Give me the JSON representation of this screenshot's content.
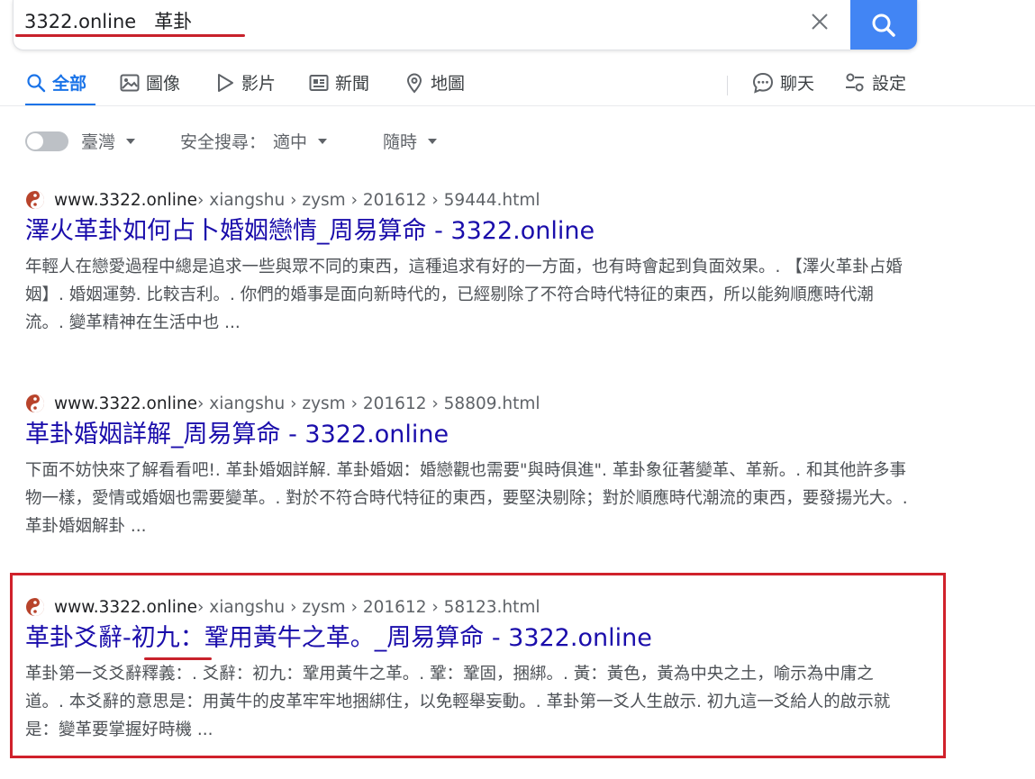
{
  "search": {
    "query": "3322.online   革卦",
    "colors": {
      "accent": "#4285f4",
      "annotation": "#c8212b"
    }
  },
  "tabs": [
    {
      "label": "全部",
      "icon": "search-icon",
      "active": true
    },
    {
      "label": "圖像",
      "icon": "image-icon"
    },
    {
      "label": "影片",
      "icon": "play-icon"
    },
    {
      "label": "新聞",
      "icon": "news-icon"
    },
    {
      "label": "地圖",
      "icon": "map-pin-icon"
    }
  ],
  "actions": [
    {
      "label": "聊天",
      "icon": "chat-icon"
    },
    {
      "label": "設定",
      "icon": "settings-sliders-icon"
    }
  ],
  "filters": {
    "region": "臺灣",
    "safe_search_label": "安全搜尋：",
    "safe_search_value": "適中",
    "time": "隨時"
  },
  "results": [
    {
      "site": "www.3322.online",
      "crumbs": " › xiangshu › zysm › 201612 › 59444.html",
      "title": "澤火革卦如何占卜婚姻戀情_周易算命 - 3322.online",
      "snippet": "年輕人在戀愛過程中總是追求一些與眾不同的東西，這種追求有好的一方面，也有時會起到負面效果。. 【澤火革卦占婚姻】. 婚姻運勢. 比較吉利。. 你們的婚事是面向新時代的，已經剔除了不符合時代特征的東西，所以能夠順應時代潮流。. 變革精神在生活中也 ..."
    },
    {
      "site": "www.3322.online",
      "crumbs": " › xiangshu › zysm › 201612 › 58809.html",
      "title": "革卦婚姻詳解_周易算命 - 3322.online",
      "snippet": "下面不妨快來了解看看吧!. 革卦婚姻詳解. 革卦婚姻：婚戀觀也需要\"與時俱進\". 革卦象征著變革、革新。. 和其他許多事物一樣，愛情或婚姻也需要變革。. 對於不符合時代特征的東西，要堅決剔除；對於順應時代潮流的東西，要發揚光大。. 革卦婚姻解卦 ..."
    },
    {
      "site": "www.3322.online",
      "crumbs": " › xiangshu › zysm › 201612 › 58123.html",
      "title": "革卦爻辭-初九：鞏用黃牛之革。_周易算命 - 3322.online",
      "snippet": "革卦第一爻爻辭釋義：. 爻辭：初九：鞏用黃牛之革。. 鞏：鞏固，捆綁。. 黃：黃色，黃為中央之土，喻示為中庸之道。. 本爻辭的意思是：用黃牛的皮革牢牢地捆綁住，以免輕舉妄動。. 革卦第一爻人生啟示. 初九這一爻給人的啟示就是：變革要掌握好時機 ..."
    }
  ]
}
